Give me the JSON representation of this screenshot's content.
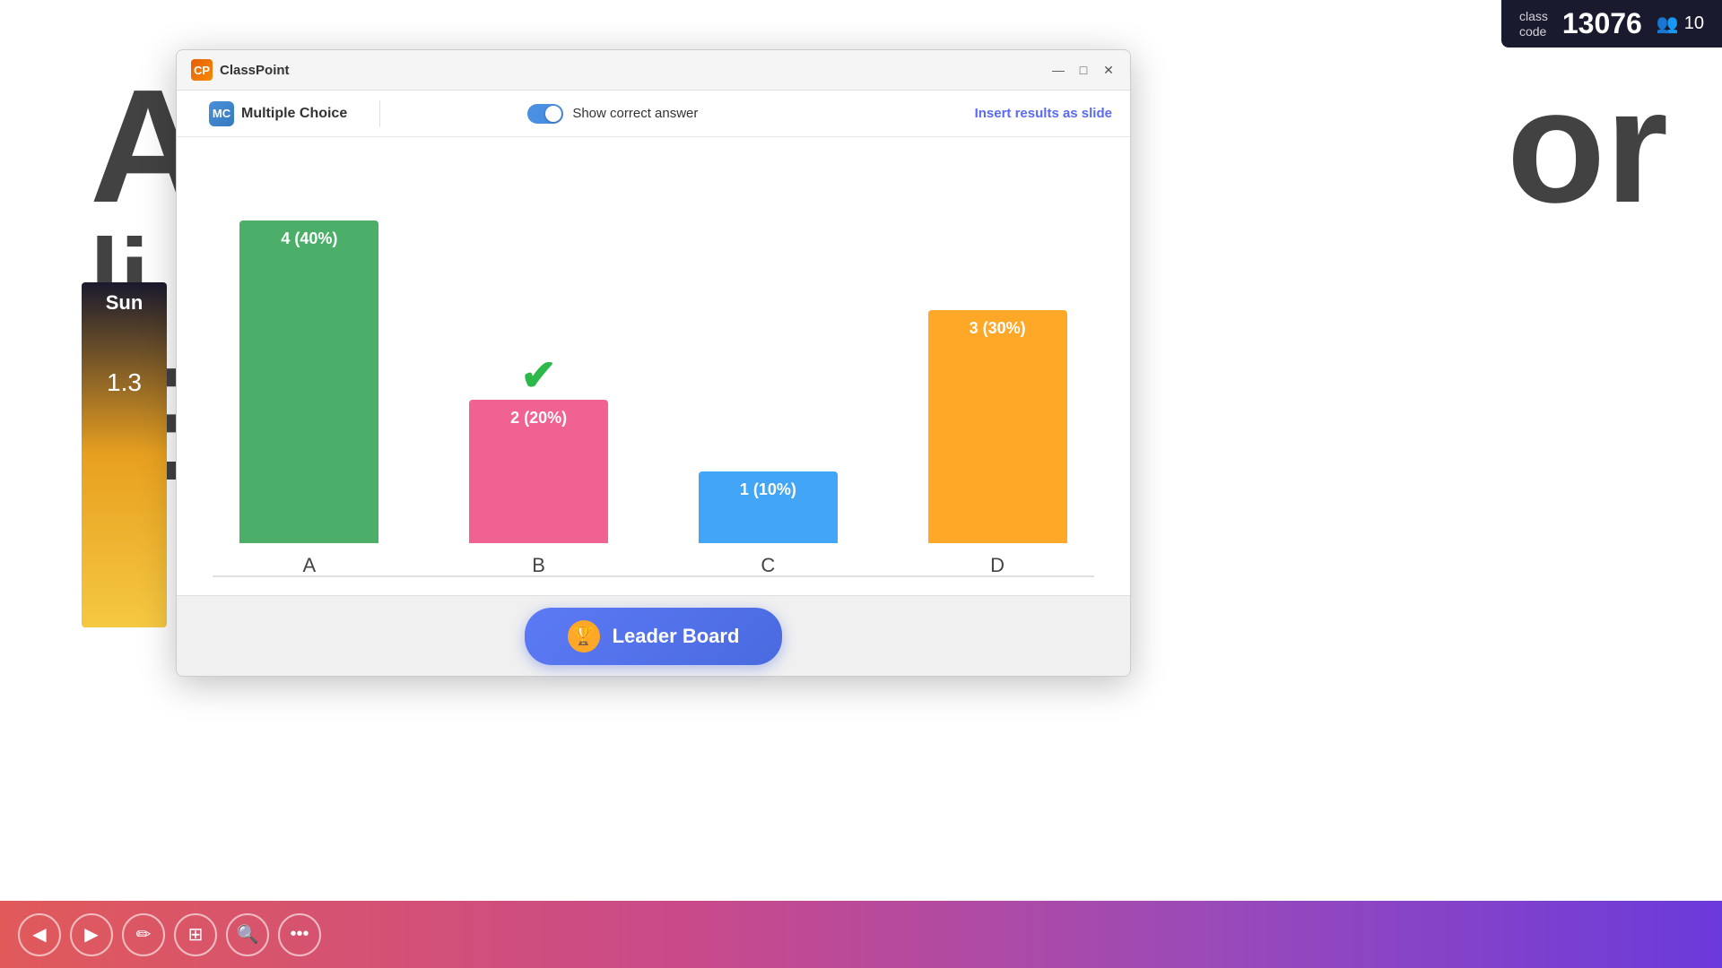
{
  "app": {
    "title": "ClassPoint",
    "class_code_label": "class\ncode",
    "class_code": "13076",
    "user_count": "10"
  },
  "slide_bg": {
    "text_a": "A",
    "text_li": "li",
    "text_e": "E",
    "text_or": "or"
  },
  "sun_widget": {
    "label": "Sun",
    "number": "1.3"
  },
  "dialog": {
    "title": "ClassPoint",
    "header": {
      "mc_label": "Multiple Choice",
      "toggle_label": "Show correct answer",
      "insert_link": "Insert results as slide"
    },
    "chart": {
      "bars": [
        {
          "label": "A",
          "value": "4 (40%)",
          "color_class": "bar-a"
        },
        {
          "label": "B",
          "value": "2 (20%)",
          "color_class": "bar-b",
          "correct": true
        },
        {
          "label": "C",
          "value": "1 (10%)",
          "color_class": "bar-c"
        },
        {
          "label": "D",
          "value": "3 (30%)",
          "color_class": "bar-d"
        }
      ]
    },
    "footer": {
      "leader_board_label": "Leader Board"
    }
  },
  "toolbar": {
    "buttons": [
      "◀",
      "▶",
      "✏",
      "⊞",
      "🔍",
      "•••"
    ]
  },
  "window_controls": {
    "minimize": "—",
    "maximize": "□",
    "close": "✕"
  }
}
